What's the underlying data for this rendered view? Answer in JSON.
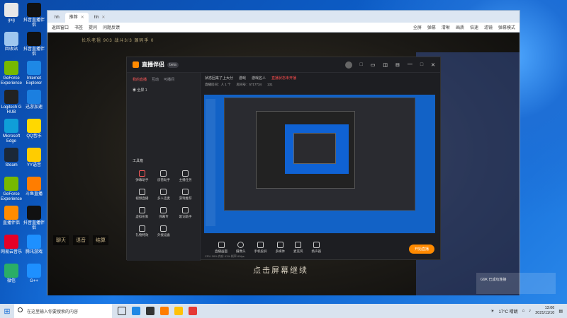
{
  "desktop": {
    "icons": [
      {
        "label": "gxg",
        "color": "#e8e8e8"
      },
      {
        "label": "抖音直播伴侣",
        "color": "#111"
      },
      {
        "label": "回收站",
        "color": "#9fc7ef"
      },
      {
        "label": "抖音直播伴侣",
        "color": "#111"
      },
      {
        "label": "GeForce Experience",
        "color": "#76b900"
      },
      {
        "label": "Internet Explorer",
        "color": "#1e88e5"
      },
      {
        "label": "Logitech G HUB",
        "color": "#222"
      },
      {
        "label": "迅游加速",
        "color": "#1b7fe0"
      },
      {
        "label": "Microsoft Edge",
        "color": "#0f9ed8"
      },
      {
        "label": "QQ音乐",
        "color": "#ffd800"
      },
      {
        "label": "Steam",
        "color": "#1b2838"
      },
      {
        "label": "YY语音",
        "color": "#ffcc00"
      },
      {
        "label": "GeForce Experience",
        "color": "#76b900"
      },
      {
        "label": "斗鱼直播",
        "color": "#ff7d00"
      },
      {
        "label": "直播伴侣",
        "color": "#ff8c00"
      },
      {
        "label": "抖音直播伴侣",
        "color": "#111"
      },
      {
        "label": "网易云音乐",
        "color": "#e60026"
      },
      {
        "label": "腾讯游戏",
        "color": "#1e90ff"
      },
      {
        "label": "微信",
        "color": "#2aae67"
      },
      {
        "label": "G++",
        "color": "#1e90ff"
      }
    ]
  },
  "browser": {
    "tabs": [
      {
        "label": "hh"
      },
      {
        "label": "推荐"
      },
      {
        "label": "hh"
      }
    ],
    "toolbar": [
      "返回窗口",
      "书签",
      "提问",
      "问题反馈"
    ],
    "right_tools": [
      "全屏",
      "弹幕",
      "清晰",
      "画质",
      "倍速",
      "滤镜",
      "弹幕模式"
    ]
  },
  "game": {
    "topline": "长乐老祖 903    战斗3/3    源码手 0",
    "bottom_buttons": [
      "聊天",
      "语音",
      "结算"
    ],
    "caption": "点击屏幕继续"
  },
  "zhibo": {
    "title": "直播伴侣",
    "version": "beta",
    "window_controls": [
      "□",
      "▭",
      "◫",
      "⊟",
      "—",
      "□",
      "✕"
    ],
    "left_tabs": [
      "我的直播",
      "互动",
      "可播间"
    ],
    "scene": "全屏 1",
    "tools_title": "工具箱",
    "tools": [
      "弹幕助手",
      "房管助手",
      "主播任务",
      "视频直播",
      "多人连麦",
      "游戏推荐",
      "虚拟形象",
      "弹幕专",
      "歌词助手",
      "礼物特效",
      "外接设备"
    ],
    "info_line": [
      "状态回来了上大分",
      "游戏",
      "游戏名人",
      "直播状态未开播"
    ],
    "info_line2": [
      "直播房间：人 1 个",
      "房间号：5717734",
      "131"
    ],
    "controls": [
      "直播画面",
      "摄像头",
      "手机投屏",
      "多媒体",
      "麦克风",
      "扬声器"
    ],
    "start_label": "开始直播",
    "status": "CPU 18%    内存 41%    帧率 60fps"
  },
  "taskbar": {
    "search_placeholder": "在这里输入你要搜索的内容",
    "weather": "17°C 晴朗",
    "time": "13:06",
    "date": "2021/11/10"
  },
  "notification": {
    "text": "G9K 已成功连接"
  }
}
